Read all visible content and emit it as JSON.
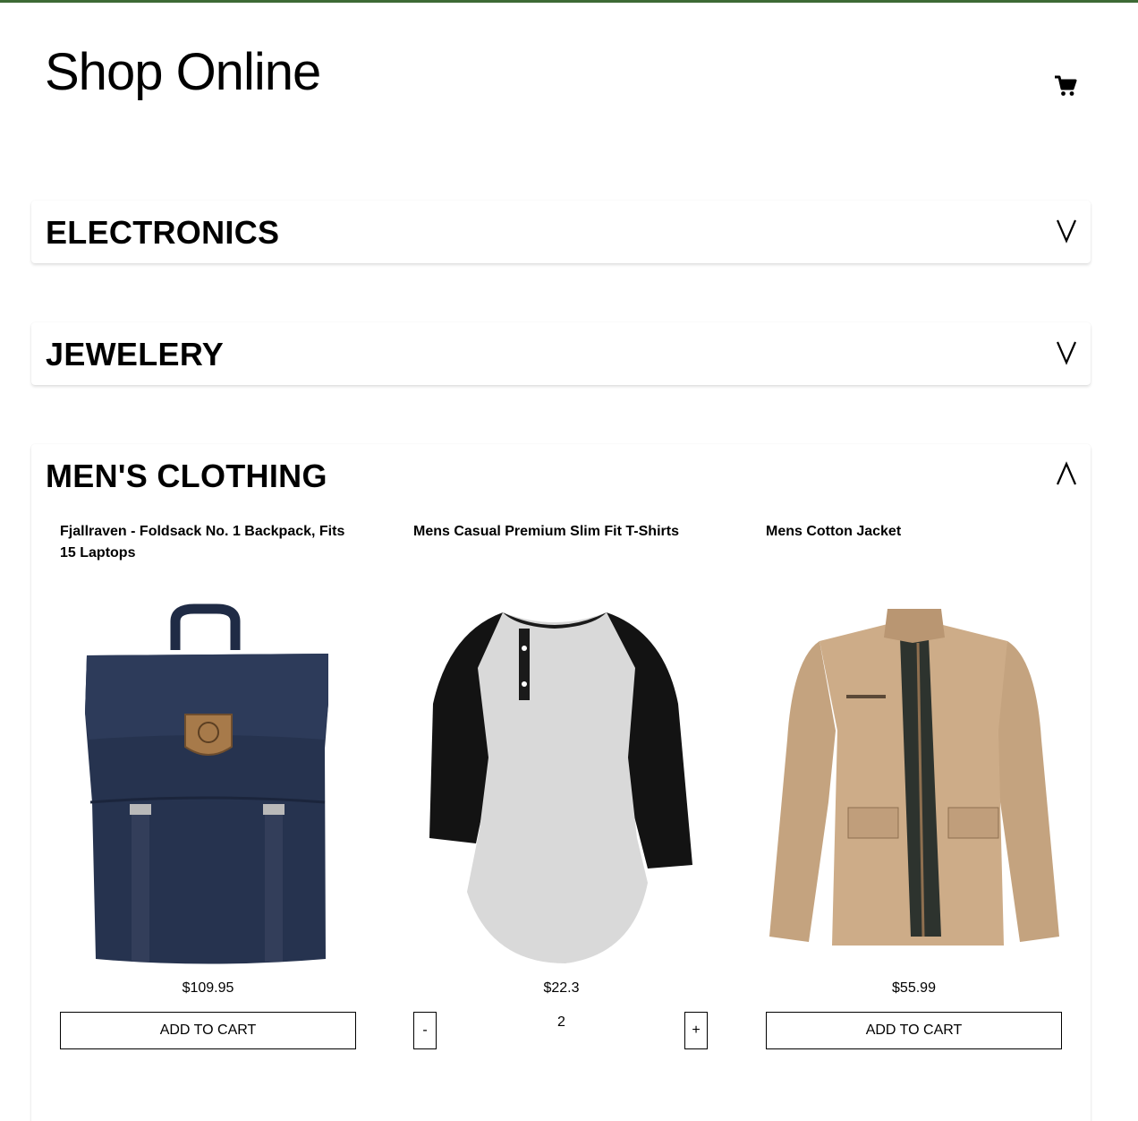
{
  "header": {
    "title": "Shop Online",
    "cart_icon": "cart-icon"
  },
  "categories": [
    {
      "title": "ELECTRONICS",
      "chevron": "V",
      "expanded": false
    },
    {
      "title": "JEWELERY",
      "chevron": "V",
      "expanded": false
    },
    {
      "title": "MEN'S CLOTHING",
      "chevron": "Λ",
      "expanded": true,
      "products": [
        {
          "title": "Fjallraven - Foldsack No. 1 Backpack, Fits 15 Laptops",
          "price": "$109.95",
          "button": "ADD TO CART",
          "image_icon": "backpack-image"
        },
        {
          "title": "Mens Casual Premium Slim Fit T-Shirts",
          "price": "$22.3",
          "decrement": "-",
          "quantity": "2",
          "increment": "+",
          "image_icon": "tshirt-image"
        },
        {
          "title": "Mens Cotton Jacket",
          "price": "$55.99",
          "button": "ADD TO CART",
          "image_icon": "jacket-image"
        }
      ]
    }
  ],
  "colors": {
    "top_stripe": "#3d6a35",
    "backpack": "#24324f",
    "tshirt_body": "#d6d6d6",
    "tshirt_sleeve": "#111111",
    "jacket": "#c9a985"
  }
}
